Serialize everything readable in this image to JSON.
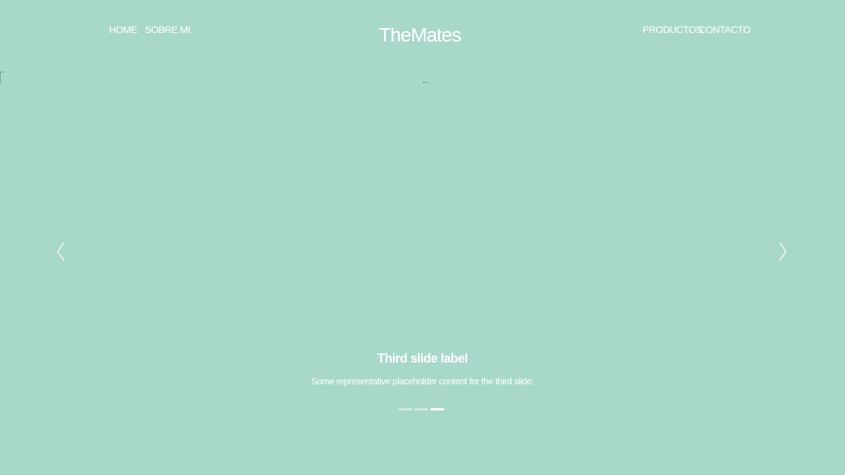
{
  "navbar": {
    "brand": "TheMates",
    "left_links": [
      {
        "label": "HOME"
      },
      {
        "label": "SOBRE MI"
      }
    ],
    "right_links": [
      {
        "label": "PRODUCTOS"
      },
      {
        "label": "CONTACTO"
      }
    ]
  },
  "carousel": {
    "image_alt": "...",
    "prev_icon": "chevron-left-icon",
    "next_icon": "chevron-right-icon",
    "caption": {
      "title": "Third slide label",
      "text": "Some representative placeholder content for the third slide."
    },
    "indicators": [
      {
        "active": false
      },
      {
        "active": false
      },
      {
        "active": true
      }
    ],
    "active_slide": 3,
    "slide_count": 3
  },
  "colors": {
    "background": "#a8d8ca",
    "text": "#ffffff"
  }
}
